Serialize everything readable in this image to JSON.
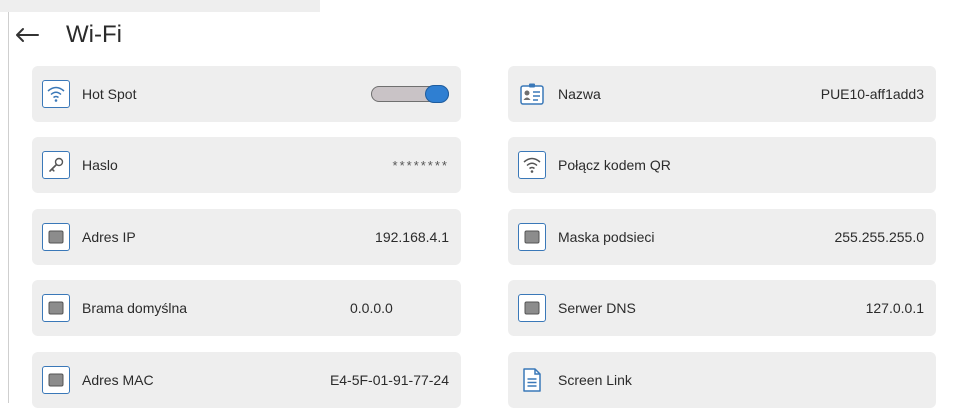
{
  "header": {
    "title": "Wi-Fi"
  },
  "left": {
    "hotspot": {
      "label": "Hot Spot",
      "enabled": true
    },
    "password": {
      "label": "Haslo",
      "value": "********"
    },
    "ip": {
      "label": "Adres IP",
      "value": "192.168.4.1"
    },
    "gateway": {
      "label": "Brama domyślna",
      "value": "0.0.0.0"
    },
    "mac": {
      "label": "Adres MAC",
      "value": "E4-5F-01-91-77-24"
    }
  },
  "right": {
    "name": {
      "label": "Nazwa",
      "value": "PUE10-aff1add3"
    },
    "qr": {
      "label": "Połącz kodem QR"
    },
    "mask": {
      "label": "Maska podsieci",
      "value": "255.255.255.0"
    },
    "dns": {
      "label": "Serwer DNS",
      "value": "127.0.0.1"
    },
    "screenlink": {
      "label": "Screen Link"
    }
  },
  "colors": {
    "accent": "#3a78b8",
    "tile": "#eeeeee",
    "toggle_knob": "#2f7fd2"
  }
}
